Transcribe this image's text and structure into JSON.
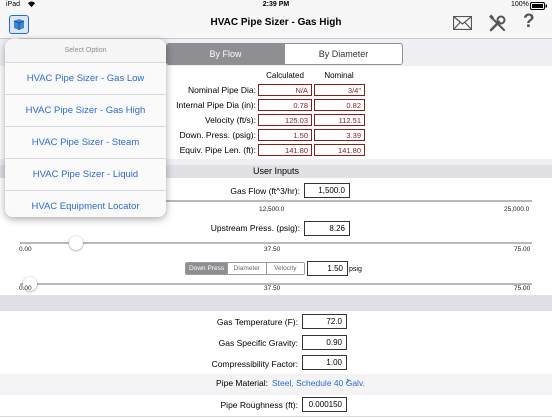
{
  "status": {
    "carrier": "iPad",
    "time": "2:39 PM",
    "battery": "100%"
  },
  "nav": {
    "title": "HVAC Pipe Sizer - Gas High"
  },
  "segment": {
    "by_flow": "By Flow",
    "by_diameter": "By Diameter"
  },
  "results": {
    "col_calculated": "Calculated",
    "col_nominal": "Nominal",
    "rows": [
      {
        "label": "Nominal Pipe Dia:",
        "calc": "N/A",
        "nom": "3/4\""
      },
      {
        "label": "Internal Pipe Dia (in):",
        "calc": "0.78",
        "nom": "0.82"
      },
      {
        "label": "Velocity (ft/s):",
        "calc": "125.03",
        "nom": "112.51"
      },
      {
        "label": "Down. Press. (psig):",
        "calc": "1.50",
        "nom": "3.39"
      },
      {
        "label": "Equiv. Pipe Len. (ft):",
        "calc": "141.80",
        "nom": "141.80"
      }
    ]
  },
  "inputs": {
    "section_title": "User Inputs",
    "gas_flow_label": "Gas Flow (ft^3/hr):",
    "gas_flow_value": "1,500.0",
    "gas_flow_ticks": [
      "12,500.0",
      "25,000.0"
    ],
    "gas_flow_level": 0.06,
    "upstream_label": "Upstream Press. (psig):",
    "upstream_value": "8.26",
    "upstream_ticks": [
      "0.00",
      "37.50",
      "75.00"
    ],
    "upstream_level": 0.11,
    "mode_tabs": [
      "Down Press",
      "Diameter",
      "Velocity"
    ],
    "mode_value": "1.50",
    "mode_unit": "psig",
    "mode_ticks": [
      "0.00",
      "37.50",
      "75.00"
    ],
    "mode_level": 0.02
  },
  "props": {
    "gas_temp_label": "Gas Temperature (F):",
    "gas_temp_value": "72.0",
    "gravity_label": "Gas Specific Gravity:",
    "gravity_value": "0.90",
    "compress_label": "Compressibility Factor:",
    "compress_value": "1.00",
    "material_label": "Pipe Material:",
    "material_value": "Steel, Schedule 40 Galv.",
    "roughness_label": "Pipe Roughness (ft):",
    "roughness_value": "0.000150"
  },
  "menu": {
    "header": "Select Option",
    "items": [
      "HVAC Pipe Sizer - Gas Low",
      "HVAC Pipe Sizer - Gas High",
      "HVAC Pipe Sizer - Steam",
      "HVAC Pipe Sizer - Liquid",
      "HVAC Equipment Locator"
    ]
  },
  "colors": {
    "accent": "#2a6ad8",
    "result_text": "#8b1c1c"
  }
}
